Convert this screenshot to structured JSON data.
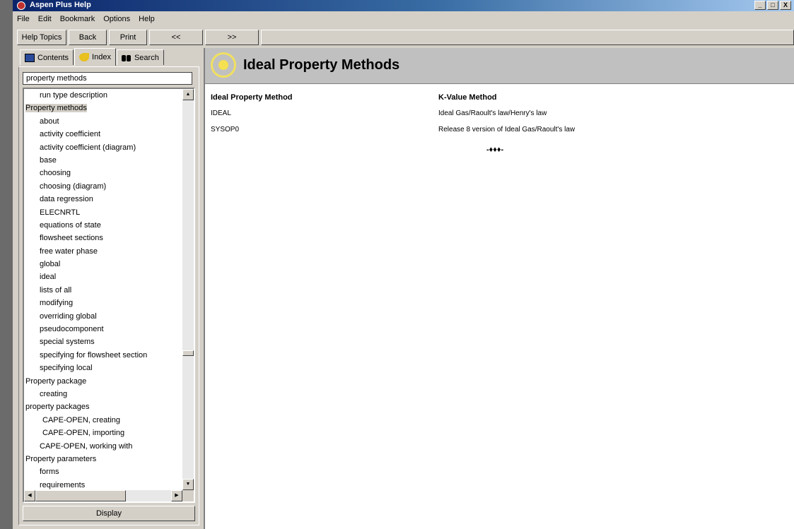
{
  "window": {
    "title": "Aspen Plus Help",
    "controls": [
      "_",
      "□",
      "X"
    ]
  },
  "menu": [
    "File",
    "Edit",
    "Bookmark",
    "Options",
    "Help"
  ],
  "toolbar": {
    "help_topics": "Help Topics",
    "back": "Back",
    "print": "Print",
    "prev": "<<",
    "next": ">>"
  },
  "tabs": [
    {
      "label": "Contents",
      "icon": "book-icon"
    },
    {
      "label": "Index",
      "icon": "key-icon",
      "active": true
    },
    {
      "label": "Search",
      "icon": "binoculars-icon"
    }
  ],
  "index": {
    "search_value": "property methods",
    "items": [
      {
        "text": "run type description",
        "level": 1
      },
      {
        "text": "Property methods",
        "level": 0,
        "selected": true
      },
      {
        "text": "about",
        "level": 1
      },
      {
        "text": "activity coefficient",
        "level": 1
      },
      {
        "text": "activity coefficient (diagram)",
        "level": 1
      },
      {
        "text": "base",
        "level": 1
      },
      {
        "text": "choosing",
        "level": 1
      },
      {
        "text": "choosing (diagram)",
        "level": 1
      },
      {
        "text": "data regression",
        "level": 1
      },
      {
        "text": "ELECNRTL",
        "level": 1
      },
      {
        "text": "equations of state",
        "level": 1
      },
      {
        "text": "flowsheet sections",
        "level": 1
      },
      {
        "text": "free water phase",
        "level": 1
      },
      {
        "text": "global",
        "level": 1
      },
      {
        "text": "ideal",
        "level": 1
      },
      {
        "text": "lists of all",
        "level": 1
      },
      {
        "text": "modifying",
        "level": 1
      },
      {
        "text": "overriding global",
        "level": 1
      },
      {
        "text": "pseudocomponent",
        "level": 1
      },
      {
        "text": "special systems",
        "level": 1
      },
      {
        "text": "specifying for flowsheet section",
        "level": 1
      },
      {
        "text": "specifying local",
        "level": 1
      },
      {
        "text": "Property package",
        "level": 0
      },
      {
        "text": "creating",
        "level": 1
      },
      {
        "text": "property packages",
        "level": 0
      },
      {
        "text": "CAPE-OPEN, creating",
        "level": 2
      },
      {
        "text": "CAPE-OPEN, importing",
        "level": 2
      },
      {
        "text": "CAPE-OPEN, working with",
        "level": 1
      },
      {
        "text": "Property parameters",
        "level": 0
      },
      {
        "text": "forms",
        "level": 1
      },
      {
        "text": "requirements",
        "level": 1
      }
    ],
    "display_button": "Display"
  },
  "content": {
    "title": "Ideal Property Methods",
    "table": {
      "headers": [
        "Ideal Property Method",
        "K-Value Method"
      ],
      "rows": [
        [
          "IDEAL",
          "Ideal Gas/Raoult's law/Henry's law"
        ],
        [
          "SYSOP0",
          "Release 8 version of Ideal Gas/Raoult's law"
        ]
      ]
    },
    "separator": "-♦♦♦-"
  },
  "colors": {
    "title_bar": "#0a246a",
    "chrome": "#d4d0c8",
    "heading_band": "#c0c0c0",
    "logo": "#f5e050"
  }
}
